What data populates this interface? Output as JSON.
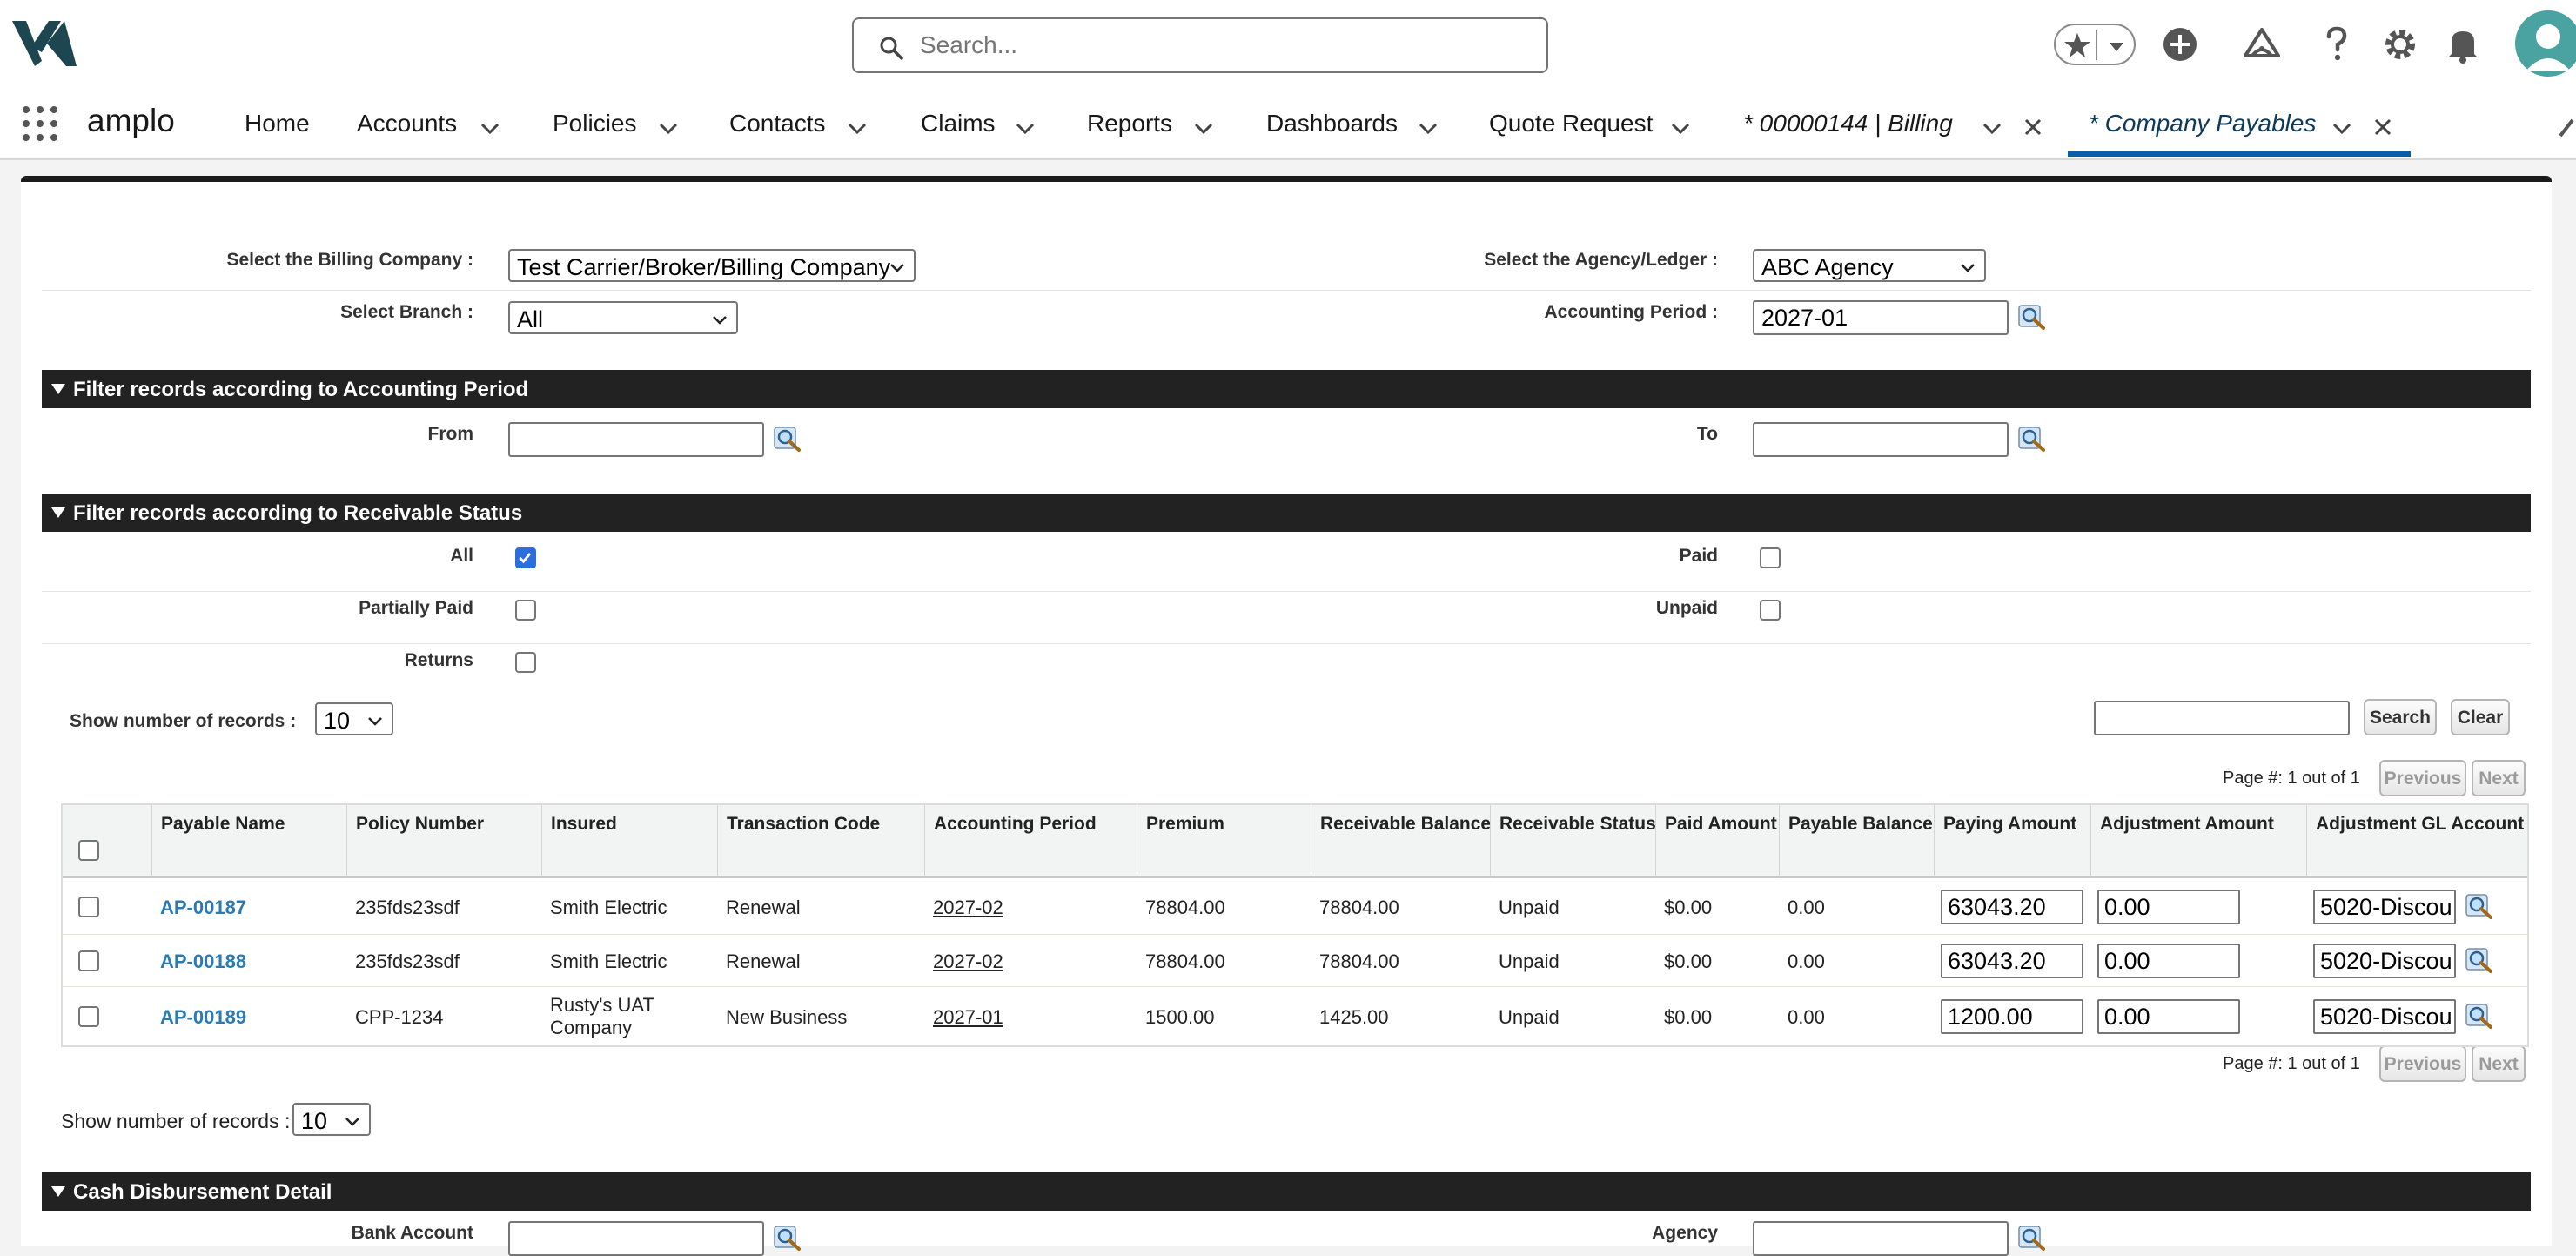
{
  "header": {
    "search_placeholder": "Search...",
    "icons": [
      "logo-icon",
      "search-icon",
      "star-icon",
      "chevron-down-icon",
      "add-icon",
      "trailhead-icon",
      "help-icon",
      "gear-icon",
      "bell-icon",
      "user-avatar-icon"
    ]
  },
  "nav": {
    "app_name": "amplo",
    "items": [
      "Home",
      "Accounts",
      "Policies",
      "Contacts",
      "Claims",
      "Reports",
      "Dashboards",
      "Quote Request"
    ],
    "tabs": [
      "* 00000144 | Billing",
      "* Company Payables"
    ],
    "accent_color": "#0b5cab"
  },
  "form": {
    "billing_company_label": "Select the Billing Company :",
    "billing_company_value": "Test Carrier/Broker/Billing Company",
    "agency_label": "Select the Agency/Ledger :",
    "agency_value": "ABC Agency",
    "branch_label": "Select Branch :",
    "branch_value": "All",
    "accounting_period_label": "Accounting Period :",
    "accounting_period_value": "2027-01"
  },
  "filter_period": {
    "title": "Filter records according to Accounting Period",
    "from_label": "From",
    "to_label": "To",
    "from_value": "",
    "to_value": ""
  },
  "filter_status": {
    "title": "Filter records according to Receivable Status",
    "all_label": "All",
    "all_checked": true,
    "paid_label": "Paid",
    "partially_paid_label": "Partially Paid",
    "unpaid_label": "Unpaid",
    "returns_label": "Returns"
  },
  "controls": {
    "show_records_label": "Show number of records :",
    "show_records_value": "10",
    "search_button": "Search",
    "clear_button": "Clear",
    "page_info": "Page #: 1 out of 1",
    "previous_button": "Previous",
    "next_button": "Next",
    "bottom_show_records_label": "Show number of records :",
    "bottom_show_records_value": "10"
  },
  "table": {
    "columns": [
      "Payable Name",
      "Policy Number",
      "Insured",
      "Transaction Code",
      "Accounting Period",
      "Premium",
      "Receivable Balance",
      "Receivable Status",
      "Paid Amount",
      "Payable Balance",
      "Paying Amount",
      "Adjustment Amount",
      "Adjustment GL Account"
    ],
    "rows": [
      {
        "payable_name": "AP-00187",
        "policy_number": "235fds23sdf",
        "insured_1": "Smith Electric",
        "insured_2": "",
        "transaction_code": "Renewal",
        "accounting_period": "2027-02",
        "premium": "78804.00",
        "receivable_balance": "78804.00",
        "receivable_status": "Unpaid",
        "paid_amount": "$0.00",
        "payable_balance": "0.00",
        "paying_amount": "63043.20",
        "adjustment_amount": "0.00",
        "adjustment_gl_account": "5020-Discou"
      },
      {
        "payable_name": "AP-00188",
        "policy_number": "235fds23sdf",
        "insured_1": "Smith Electric",
        "insured_2": "",
        "transaction_code": "Renewal",
        "accounting_period": "2027-02",
        "premium": "78804.00",
        "receivable_balance": "78804.00",
        "receivable_status": "Unpaid",
        "paid_amount": "$0.00",
        "payable_balance": "0.00",
        "paying_amount": "63043.20",
        "adjustment_amount": "0.00",
        "adjustment_gl_account": "5020-Discou"
      },
      {
        "payable_name": "AP-00189",
        "policy_number": "CPP-1234",
        "insured_1": "Rusty's UAT",
        "insured_2": "Company",
        "transaction_code": "New Business",
        "accounting_period": "2027-01",
        "premium": "1500.00",
        "receivable_balance": "1425.00",
        "receivable_status": "Unpaid",
        "paid_amount": "$0.00",
        "payable_balance": "0.00",
        "paying_amount": "1200.00",
        "adjustment_amount": "0.00",
        "adjustment_gl_account": "5020-Discou"
      }
    ]
  },
  "cash_disbursement": {
    "title": "Cash Disbursement Detail",
    "bank_account_label": "Bank Account",
    "agency_label": "Agency"
  }
}
